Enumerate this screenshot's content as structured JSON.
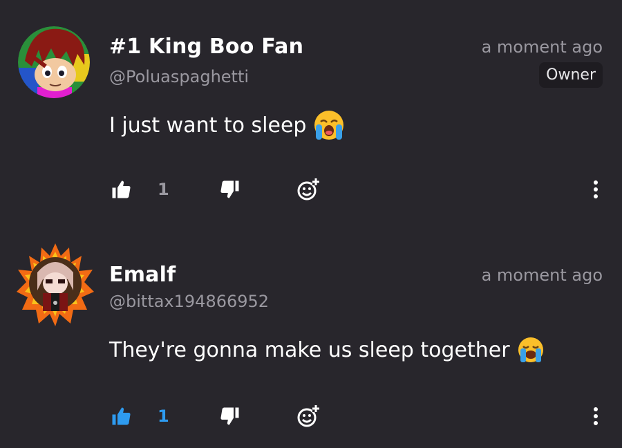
{
  "comments": [
    {
      "display_name": "#1 King Boo Fan",
      "handle": "@Poluaspaghetti",
      "time": "a moment ago",
      "badge": "Owner",
      "text": "I just want to sleep",
      "emoji": "crying-face-emoji",
      "likes": "1",
      "liked": false
    },
    {
      "display_name": "Emalf",
      "handle": "@bittax194866952",
      "time": "a moment ago",
      "text": "They're gonna make us sleep together",
      "emoji": "loudly-crying-face-emoji",
      "likes": "1",
      "liked": true
    }
  ],
  "colors": {
    "background": "#28262c",
    "muted": "#9a98a0",
    "accent": "#2e9bf0"
  }
}
